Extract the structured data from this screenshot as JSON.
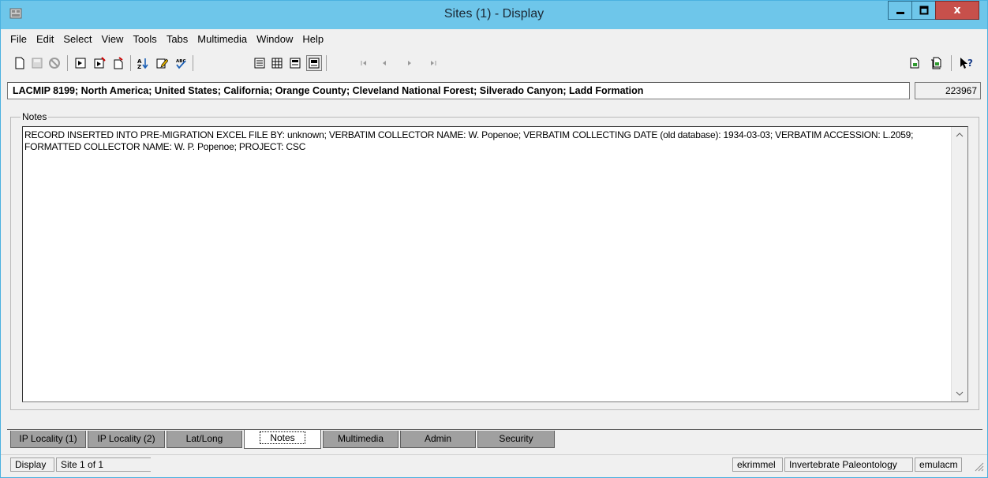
{
  "window": {
    "title": "Sites (1) - Display",
    "close_label": "x"
  },
  "menu": [
    "File",
    "Edit",
    "Select",
    "View",
    "Tools",
    "Tabs",
    "Multimedia",
    "Window",
    "Help"
  ],
  "toolbar": {
    "icons": [
      "new-record-icon",
      "save-icon",
      "cancel-icon",
      "query-icon",
      "query-result-icon",
      "append-icon",
      "sort-icon",
      "edit-icon",
      "spell-check-icon",
      "list-view-icon",
      "table-view-icon",
      "page-view-icon",
      "details-view-icon",
      "first-record-icon",
      "previous-record-icon",
      "next-record-icon",
      "last-record-icon",
      "attach-icon",
      "attach-all-icon",
      "context-help-icon"
    ]
  },
  "summary": {
    "text": "LACMIP 8199; North America; United States; California; Orange County; Cleveland National Forest; Silverado Canyon; Ladd Formation",
    "irn": "223967"
  },
  "notes": {
    "legend": "Notes",
    "text": "RECORD INSERTED INTO PRE-MIGRATION EXCEL FILE BY: unknown; VERBATIM COLLECTOR NAME: W. Popenoe; VERBATIM COLLECTING DATE (old database): 1934-03-03; VERBATIM ACCESSION: L.2059; FORMATTED COLLECTOR NAME: W. P. Popenoe; PROJECT: CSC"
  },
  "tabs": [
    "IP Locality (1)",
    "IP Locality (2)",
    "Lat/Long",
    "Notes",
    "Multimedia",
    "Admin",
    "Security"
  ],
  "active_tab": "Notes",
  "status": {
    "mode": "Display",
    "record": "Site 1 of 1",
    "user": "ekrimmel",
    "department": "Invertebrate Paleontology",
    "server": "emulacm"
  }
}
